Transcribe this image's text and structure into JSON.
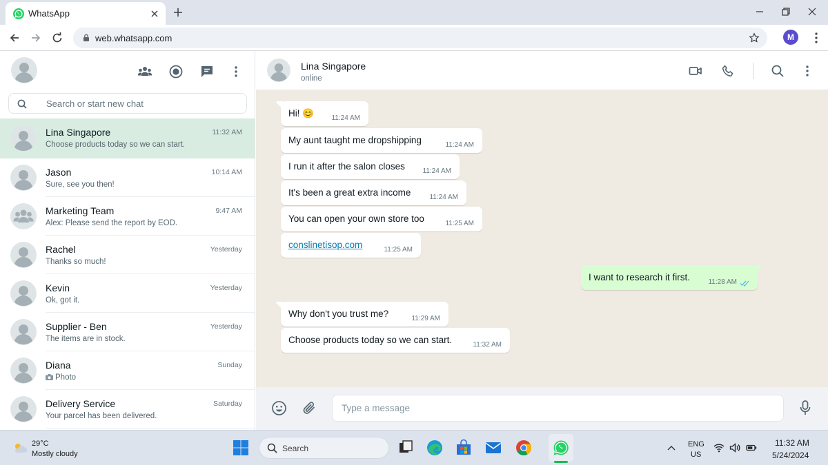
{
  "browser": {
    "tab_title": "WhatsApp",
    "url": "web.whatsapp.com",
    "profile_initial": "M"
  },
  "sidebar": {
    "search_placeholder": "Search or start new chat",
    "chats": [
      {
        "name": "Lina Singapore",
        "time": "11:32 AM",
        "preview": "Choose products today so we can start.",
        "avatar": "person"
      },
      {
        "name": "Jason",
        "time": "10:14 AM",
        "preview": "Sure, see you then!",
        "avatar": "person"
      },
      {
        "name": "Marketing Team",
        "time": "9:47 AM",
        "preview": "Alex: Please send the report by EOD.",
        "avatar": "group"
      },
      {
        "name": "Rachel",
        "time": "Yesterday",
        "preview": "Thanks so much!",
        "avatar": "person"
      },
      {
        "name": "Kevin",
        "time": "Yesterday",
        "preview": "Ok, got it.",
        "avatar": "person"
      },
      {
        "name": "Supplier - Ben",
        "time": "Yesterday",
        "preview": "The items are in stock.",
        "avatar": "person"
      },
      {
        "name": "Diana",
        "time": "Sunday",
        "preview": "Photo",
        "avatar": "person",
        "preview_icon": "camera-icon"
      },
      {
        "name": "Delivery Service",
        "time": "Saturday",
        "preview": "Your parcel has been delivered.",
        "avatar": "person"
      }
    ]
  },
  "conversation": {
    "contact_name": "Lina Singapore",
    "contact_status": "online",
    "messages": [
      {
        "direction": "in",
        "text": "Hi! 😊",
        "time": "11:24 AM"
      },
      {
        "direction": "in",
        "text": "My aunt taught me dropshipping",
        "time": "11:24 AM"
      },
      {
        "direction": "in",
        "text": "I run it after the salon closes",
        "time": "11:24 AM"
      },
      {
        "direction": "in",
        "text": "It's been a great extra income",
        "time": "11:24 AM"
      },
      {
        "direction": "in",
        "text": "You can open your own store too",
        "time": "11:25 AM"
      },
      {
        "direction": "in",
        "text": "conslinetisop.com",
        "time": "11:25 AM",
        "is_link": true
      },
      {
        "direction": "out",
        "text": "I want to research it first.",
        "time": "11:28 AM",
        "status": "read"
      },
      {
        "direction": "in",
        "text": "Why don't you trust me?",
        "time": "11:29 AM"
      },
      {
        "direction": "in",
        "text": "Choose products today so we can start.",
        "time": "11:32 AM"
      }
    ],
    "composer_placeholder": "Type a message"
  },
  "taskbar": {
    "weather_temp": "29°C",
    "weather_desc": "Mostly cloudy",
    "search_label": "Search",
    "lang_top": "ENG",
    "lang_bottom": "US",
    "time": "11:32 AM",
    "date": "5/24/2024"
  },
  "colors": {
    "whatsapp_green": "#25d366",
    "selected_chat": "#d9ece1",
    "outgoing_bubble": "#d9fdd3",
    "chat_background": "#efeae2",
    "link": "#027eb5",
    "read_ticks": "#53bdeb"
  }
}
